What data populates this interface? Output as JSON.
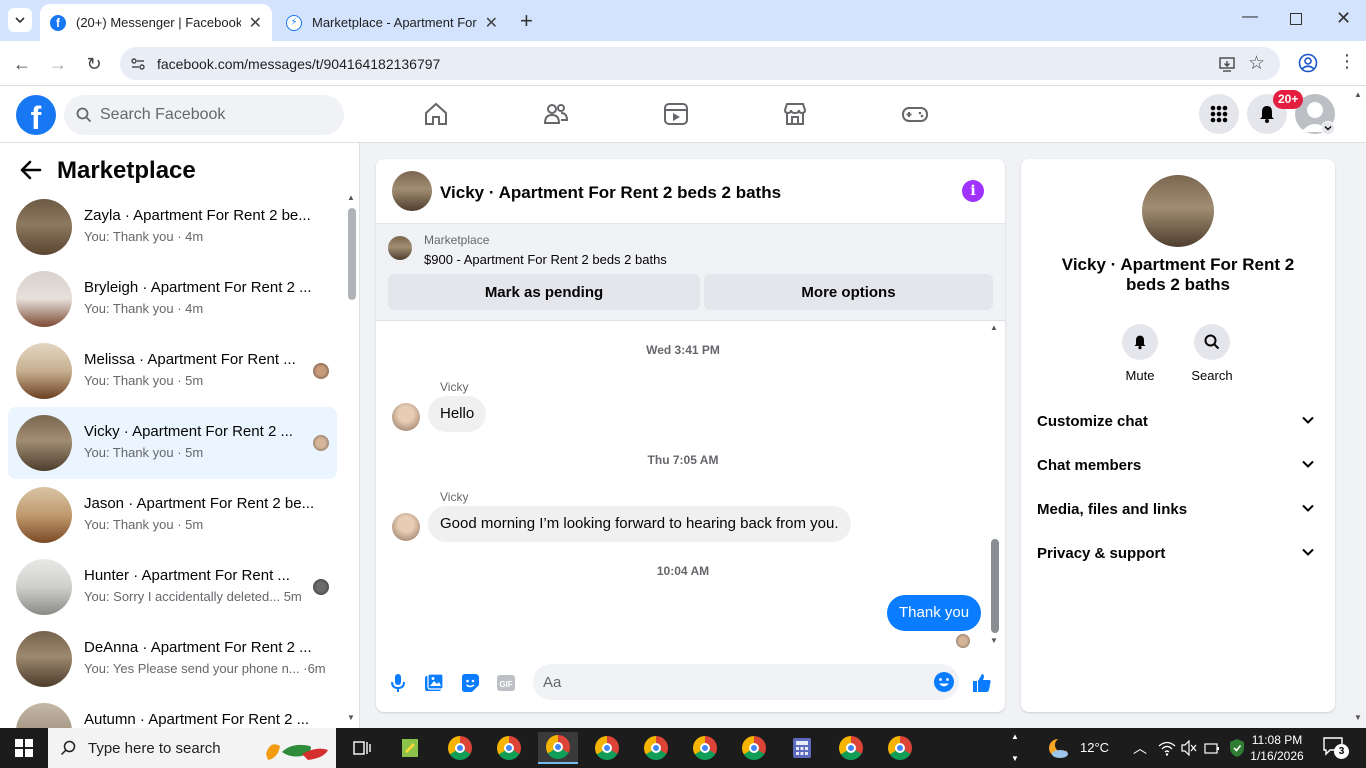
{
  "browser": {
    "tabs": [
      {
        "title": "(20+) Messenger | Facebook",
        "active": true
      },
      {
        "title": "Marketplace - Apartment For Re",
        "active": false
      }
    ],
    "url": "facebook.com/messages/t/904164182136797"
  },
  "fb_header": {
    "search_placeholder": "Search Facebook",
    "notification_badge": "20+"
  },
  "left_panel": {
    "title": "Marketplace",
    "conversations": [
      {
        "name": "Zayla · Apartment For Rent 2 be...",
        "preview": "You: Thank you · 4m"
      },
      {
        "name": "Bryleigh · Apartment For Rent 2 ...",
        "preview": "You: Thank you · 4m"
      },
      {
        "name": "Melissa · Apartment For Rent ...",
        "preview": "You: Thank you · 5m"
      },
      {
        "name": "Vicky · Apartment For Rent 2 ...",
        "preview": "You: Thank you · 5m"
      },
      {
        "name": "Jason · Apartment For Rent 2 be...",
        "preview": "You: Thank you · 5m"
      },
      {
        "name": "Hunter · Apartment For Rent ...",
        "preview": "You: Sorry I accidentally deleted...  5m"
      },
      {
        "name": "DeAnna · Apartment For Rent 2 ...",
        "preview": "You: Yes Please send your phone n... ·6m"
      },
      {
        "name": "Autumn · Apartment For Rent 2 ...",
        "preview": ""
      }
    ]
  },
  "chat": {
    "title": "Vicky · Apartment For Rent 2 beds 2 baths",
    "marketplace_label": "Marketplace",
    "listing": "$900 - Apartment For Rent 2 beds 2 baths",
    "mark_pending": "Mark as pending",
    "more_options": "More options",
    "messages": [
      {
        "timestamp": "Wed 3:41 PM",
        "sender": "Vicky",
        "text": "Hello"
      },
      {
        "timestamp": "Thu 7:05 AM",
        "sender": "Vicky",
        "text": "Good morning I’m looking forward to hearing back from you."
      },
      {
        "timestamp": "10:04 AM",
        "sender": "You",
        "text": "Thank you"
      }
    ],
    "input_placeholder": "Aa",
    "accent_color": "#0a7cff"
  },
  "right_panel": {
    "name": "Vicky · Apartment For Rent 2 beds 2 baths",
    "actions": [
      {
        "label": "Mute"
      },
      {
        "label": "Search"
      }
    ],
    "sections": [
      {
        "label": "Customize chat"
      },
      {
        "label": "Chat members"
      },
      {
        "label": "Media, files and links"
      },
      {
        "label": "Privacy & support"
      }
    ]
  },
  "taskbar": {
    "search_placeholder": "Type here to search",
    "temperature": "12°C",
    "time": "11:08 PM",
    "date": "1/16/2026",
    "notification_count": "3"
  }
}
